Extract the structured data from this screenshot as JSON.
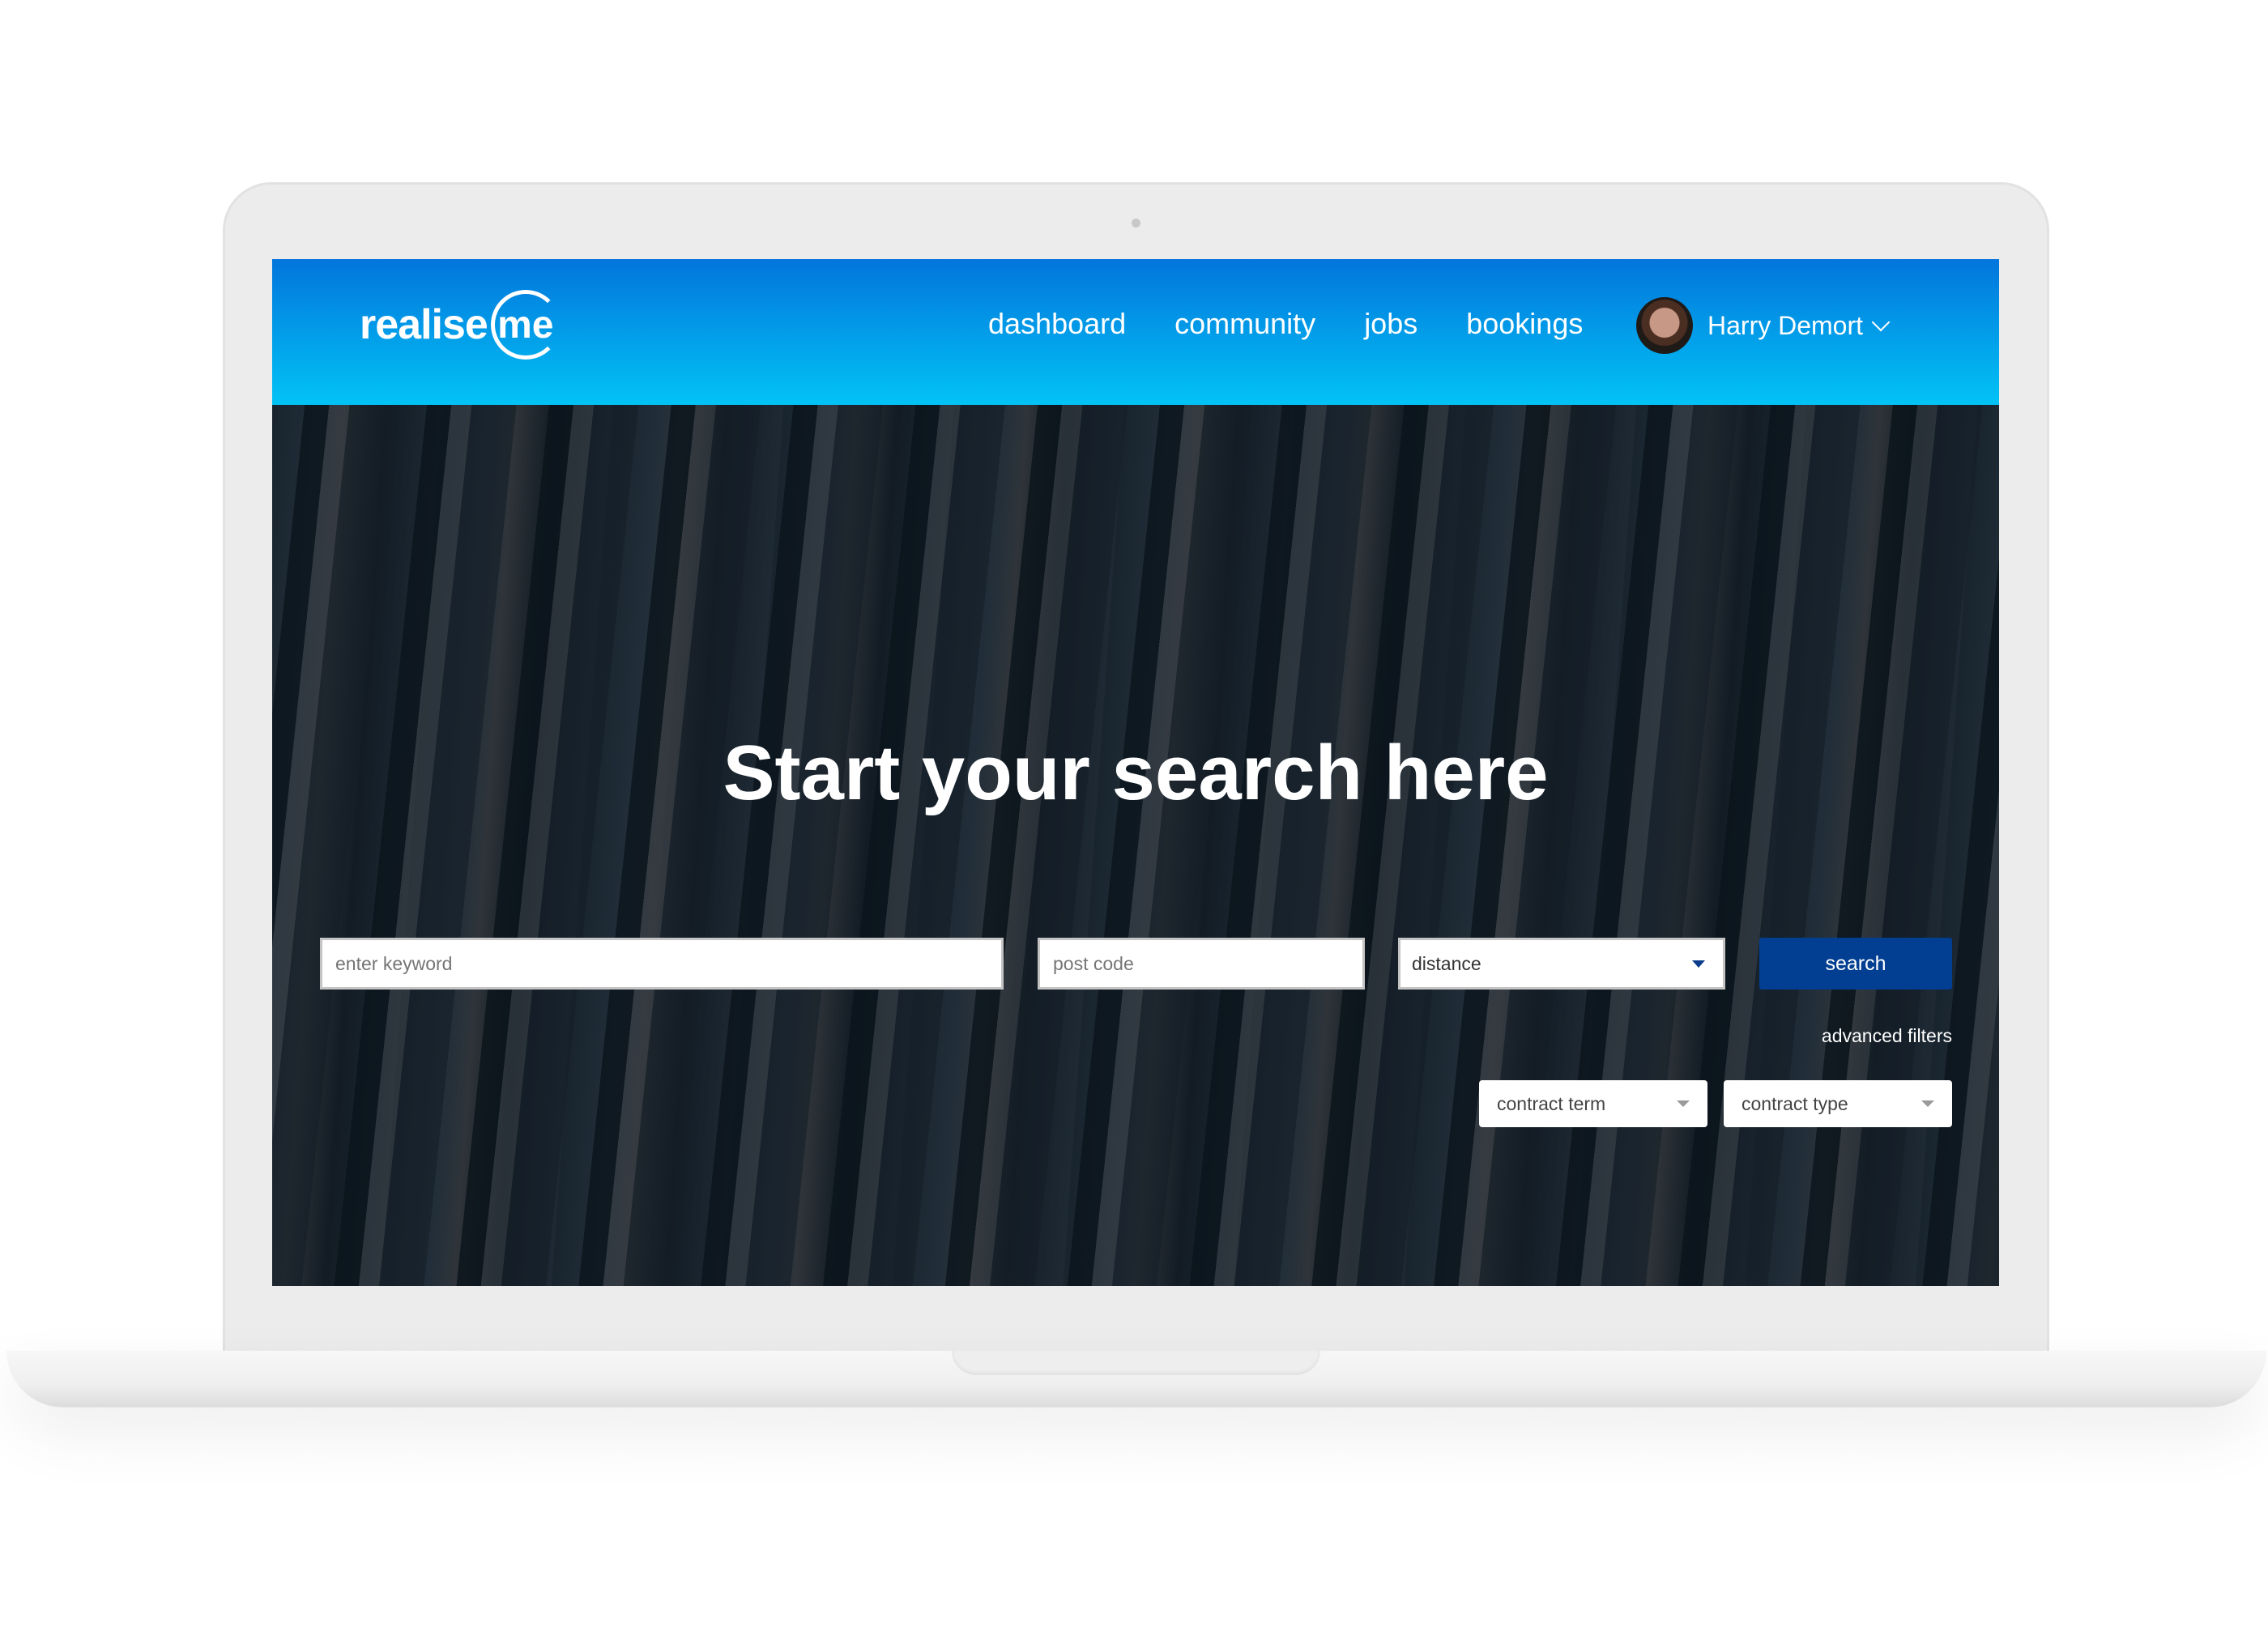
{
  "brand": {
    "word": "realise",
    "badge": "me"
  },
  "nav": {
    "items": [
      {
        "label": "dashboard"
      },
      {
        "label": "community"
      },
      {
        "label": "jobs"
      },
      {
        "label": "bookings"
      }
    ]
  },
  "user": {
    "name": "Harry Demort",
    "menu_icon": "chevron-down-icon"
  },
  "hero": {
    "title": "Start your search here"
  },
  "search": {
    "keyword_placeholder": "enter keyword",
    "postcode_placeholder": "post code",
    "distance_selected": "distance",
    "button_label": "search",
    "advanced_label": "advanced filters",
    "contract_term_selected": "contract term",
    "contract_type_selected": "contract type"
  },
  "colors": {
    "header_top": "#0275dc",
    "header_bottom": "#02c3f5",
    "search_button": "#023f92"
  }
}
